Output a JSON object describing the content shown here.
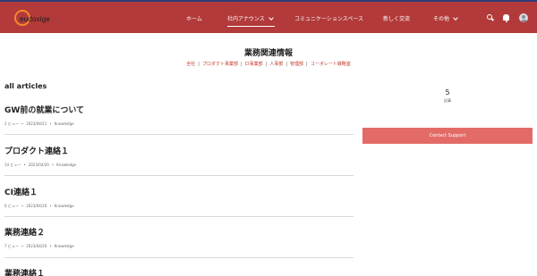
{
  "header": {
    "logo_text": "eudoxige",
    "nav": [
      {
        "label": "ホーム"
      },
      {
        "label": "社内アナウンス"
      },
      {
        "label": "コミュニケーションスペース"
      },
      {
        "label": "新しく交流"
      },
      {
        "label": "その他"
      }
    ],
    "icons": [
      "search-icon",
      "bell-icon",
      "avatar-icon"
    ],
    "colors": {
      "bar": "#b33a3a",
      "accent_top": "#2f3a7a",
      "logo_ring": "#f08a2a"
    }
  },
  "topic": {
    "title": "業務関連情報",
    "links": [
      "全社",
      "プロダクト事業部",
      "CI事業部",
      "人事部",
      "管理部",
      "コーポレート戦略室"
    ]
  },
  "articles": {
    "section_title": "all articles",
    "items": [
      {
        "title": "GW前の就業について",
        "views": "2 ビュー",
        "date": "2023/04/21",
        "tag": "Knowledge"
      },
      {
        "title": "プロダクト連絡１",
        "views": "14 ビュー",
        "date": "2023/04/20",
        "tag": "Knowledge"
      },
      {
        "title": "CI連絡１",
        "views": "6 ビュー",
        "date": "2023/04/20",
        "tag": "Knowledge"
      },
      {
        "title": "業務連絡２",
        "views": "7 ビュー",
        "date": "2023/04/20",
        "tag": "Knowledge"
      },
      {
        "title": "業務連絡１",
        "views": "",
        "date": "",
        "tag": ""
      }
    ]
  },
  "sidebar": {
    "count": "5",
    "count_label": "記事",
    "contact_label": "Contact Support",
    "button_color": "#e36b67"
  }
}
